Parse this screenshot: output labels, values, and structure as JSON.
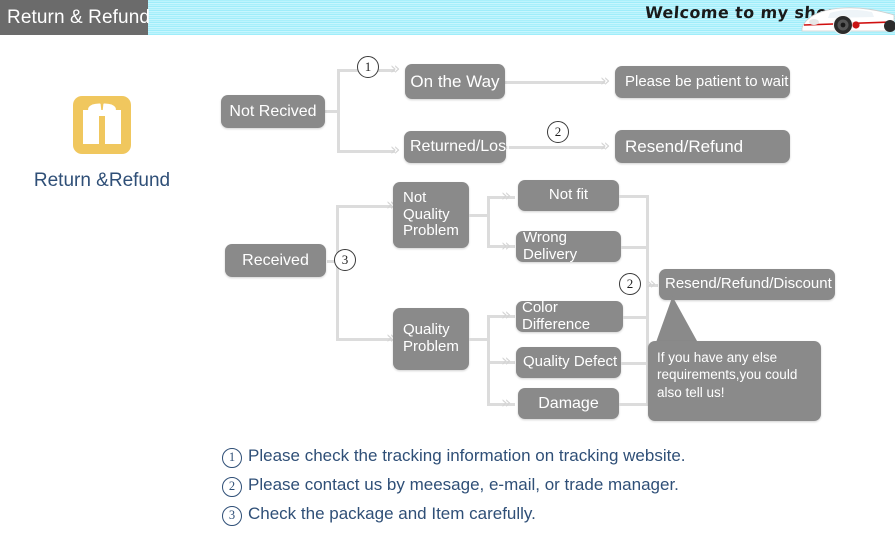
{
  "header": {
    "tab_title": "Return & Refund",
    "welcome_text": "Welcome to my shop",
    "car_icon": "sports-car-icon",
    "banner_color": "#aaf0fb",
    "tab_color": "#6b6b6b"
  },
  "brand": {
    "icon": "gift-box-icon",
    "icon_color": "#f0c75e",
    "label": "Return &Refund",
    "label_color": "#2f4f77"
  },
  "flow": {
    "box_color": "#8a8a8a",
    "connector_color": "#dcdcdc",
    "nodes": {
      "not_recived": "Not Recived",
      "on_the_way": "On the Way",
      "returned_lost": "Returned/Lost",
      "please_wait": "Please be patient to wait",
      "resend_refund": "Resend/Refund",
      "received": "Received",
      "not_quality_problem": "Not Quality Problem",
      "quality_problem": "Quality Problem",
      "not_fit": "Not fit",
      "wrong_delivery": "Wrong Delivery",
      "color_difference": "Color Difference",
      "quality_defect": "Quality Defect",
      "damage": "Damage",
      "resend_refund_discount": "Resend/Refund/Discount"
    },
    "markers": {
      "m1": "1",
      "m2_top": "2",
      "m3": "3",
      "m2_bottom": "2"
    },
    "bubble_text": "If you have any else requirements,you could also tell us!"
  },
  "notes": [
    {
      "num": "1",
      "text": "Please check the tracking information on tracking website."
    },
    {
      "num": "2",
      "text": "Please contact us by meesage, e-mail, or trade manager."
    },
    {
      "num": "3",
      "text": "Check the package and Item carefully."
    }
  ]
}
